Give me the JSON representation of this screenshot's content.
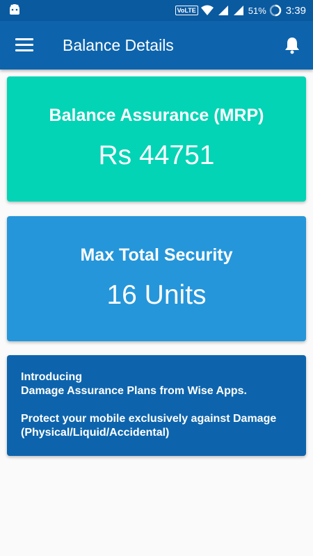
{
  "status_bar": {
    "volte": "VoLTE",
    "battery": "51%",
    "time": "3:39"
  },
  "app_bar": {
    "title": "Balance Details"
  },
  "balance_card": {
    "label": "Balance Assurance (MRP)",
    "value": "Rs 44751",
    "color": "#02d4b5"
  },
  "security_card": {
    "label": "Max Total Security",
    "value": "16 Units",
    "color": "#2596da"
  },
  "info_card": {
    "line1": "Introducing",
    "line2": "Damage Assurance Plans from Wise Apps.",
    "line3": "Protect your mobile exclusively against Damage",
    "line4": "(Physical/Liquid/Accidental)",
    "color": "#0d64ac"
  },
  "icons": {
    "status": [
      "android-icon",
      "wifi-icon",
      "signal-icon",
      "battery-icon"
    ],
    "app_bar": [
      "menu-icon",
      "bell-icon"
    ]
  }
}
